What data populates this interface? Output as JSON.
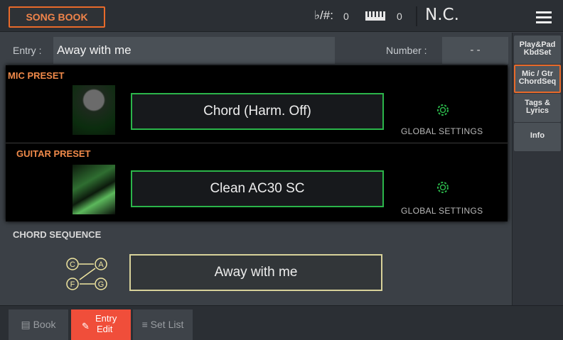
{
  "header": {
    "mode_tab": "SONG BOOK",
    "transpose_label": "♭/#:",
    "transpose_value": "0",
    "keyboard_value": "0",
    "chord_display": "N.C."
  },
  "entry": {
    "label": "Entry :",
    "value": "Away with me",
    "number_label": "Number :",
    "number_value": "- -"
  },
  "mic_preset": {
    "title": "MIC PRESET",
    "value": "Chord (Harm. Off)",
    "global": "GLOBAL SETTINGS"
  },
  "guitar_preset": {
    "title": "GUITAR PRESET",
    "value": "Clean AC30 SC",
    "global": "GLOBAL SETTINGS"
  },
  "chord_sequence": {
    "title": "CHORD SEQUENCE",
    "value": "Away with me",
    "icon_letters": [
      "C",
      "A",
      "F",
      "G"
    ]
  },
  "side_tabs": [
    {
      "line1": "Play&Pad",
      "line2": "KbdSet"
    },
    {
      "line1": "Mic / Gtr",
      "line2": "ChordSeq"
    },
    {
      "line1": "Tags &",
      "line2": "Lyrics"
    },
    {
      "line1": "Info",
      "line2": ""
    }
  ],
  "bottom_tabs": {
    "book": "Book",
    "entry_line1": "Entry",
    "entry_line2": "Edit",
    "setlist": "Set List"
  },
  "colors": {
    "accent_orange": "#e86a2a",
    "preset_green": "#2bb54a",
    "chord_yellow": "#d8d29a",
    "active_tab_red": "#f04e3a"
  }
}
